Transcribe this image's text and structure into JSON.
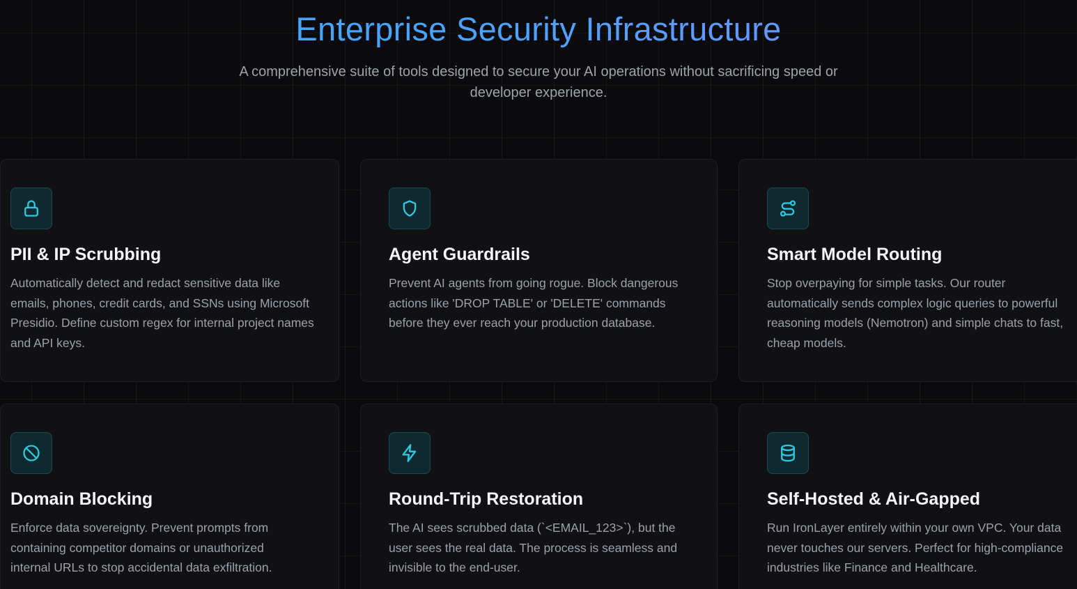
{
  "header": {
    "title": "Enterprise Security Infrastructure",
    "subtitle": "A comprehensive suite of tools designed to secure your AI operations without sacrificing speed or developer experience."
  },
  "colors": {
    "accent": "#2fc7e0",
    "title_gradient_start": "#3aa8ff",
    "title_gradient_end": "#7a8cff",
    "background": "#0b0b0d",
    "card_background": "#111114"
  },
  "features": [
    {
      "icon": "lock-icon",
      "title": "PII & IP Scrubbing",
      "description": "Automatically detect and redact sensitive data like emails, phones, credit cards, and SSNs using Microsoft Presidio. Define custom regex for internal project names and API keys."
    },
    {
      "icon": "shield-icon",
      "title": "Agent Guardrails",
      "description": "Prevent AI agents from going rogue. Block dangerous actions like 'DROP TABLE' or 'DELETE' commands before they ever reach your production database."
    },
    {
      "icon": "route-icon",
      "title": "Smart Model Routing",
      "description": "Stop overpaying for simple tasks. Our router automatically sends complex logic queries to powerful reasoning models (Nemotron) and simple chats to fast, cheap models."
    },
    {
      "icon": "ban-icon",
      "title": "Domain Blocking",
      "description": "Enforce data sovereignty. Prevent prompts from containing competitor domains or unauthorized internal URLs to stop accidental data exfiltration."
    },
    {
      "icon": "lightning-icon",
      "title": "Round-Trip Restoration",
      "description": "The AI sees scrubbed data (`<EMAIL_123>`), but the user sees the real data. The process is seamless and invisible to the end-user."
    },
    {
      "icon": "database-icon",
      "title": "Self-Hosted & Air-Gapped",
      "description": "Run IronLayer entirely within your own VPC. Your data never touches our servers. Perfect for high-compliance industries like Finance and Healthcare."
    }
  ]
}
